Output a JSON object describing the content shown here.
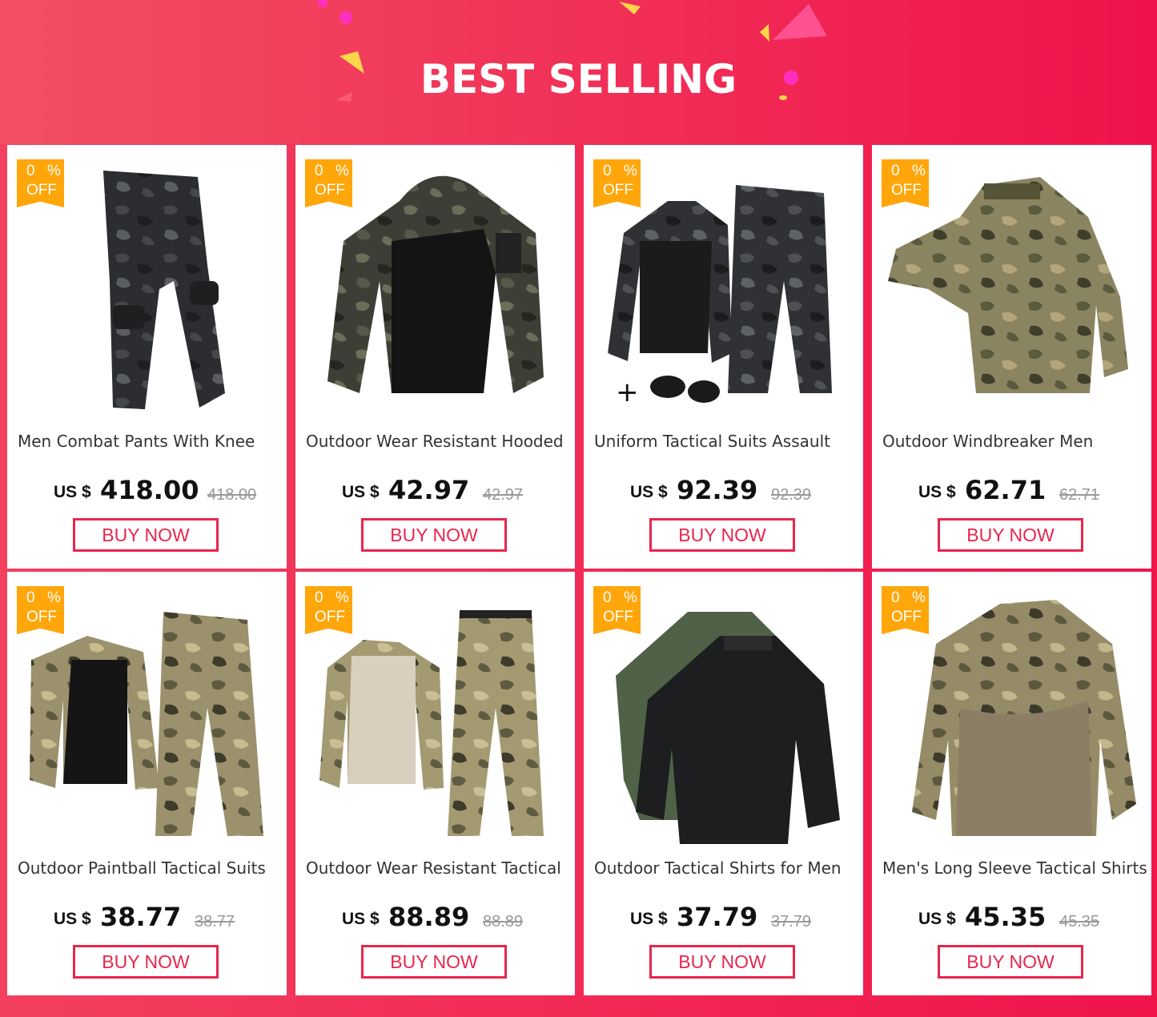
{
  "header": {
    "title": "BEST SELLING"
  },
  "colors": {
    "accent": "#e8264e",
    "badge": "#ffa60a"
  },
  "products": [
    {
      "name": "Men Combat Pants With Knee",
      "badge_pct": "0",
      "badge_sym": "%",
      "badge_off": "OFF",
      "currency": "US $",
      "price": "418.00",
      "old_price": "418.00",
      "button": "BUY NOW",
      "image": "camo-pants"
    },
    {
      "name": "Outdoor Wear Resistant Hooded",
      "badge_pct": "0",
      "badge_sym": "%",
      "badge_off": "OFF",
      "currency": "US $",
      "price": "42.97",
      "old_price": "42.97",
      "button": "BUY NOW",
      "image": "hooded-shirt"
    },
    {
      "name": "Uniform Tactical Suits Assault",
      "badge_pct": "0",
      "badge_sym": "%",
      "badge_off": "OFF",
      "currency": "US $",
      "price": "92.39",
      "old_price": "92.39",
      "button": "BUY NOW",
      "image": "suit-with-pads"
    },
    {
      "name": "Outdoor Windbreaker Men",
      "badge_pct": "0",
      "badge_sym": "%",
      "badge_off": "OFF",
      "currency": "US $",
      "price": "62.71",
      "old_price": "62.71",
      "button": "BUY NOW",
      "image": "camo-jacket"
    },
    {
      "name": "Outdoor Paintball Tactical Suits",
      "badge_pct": "0",
      "badge_sym": "%",
      "badge_off": "OFF",
      "currency": "US $",
      "price": "38.77",
      "old_price": "38.77",
      "button": "BUY NOW",
      "image": "paintball-suit"
    },
    {
      "name": "Outdoor Wear Resistant Tactical",
      "badge_pct": "0",
      "badge_sym": "%",
      "badge_off": "OFF",
      "currency": "US $",
      "price": "88.89",
      "old_price": "88.89",
      "button": "BUY NOW",
      "image": "tan-suit"
    },
    {
      "name": "Outdoor Tactical Shirts for Men",
      "badge_pct": "0",
      "badge_sym": "%",
      "badge_off": "OFF",
      "currency": "US $",
      "price": "37.79",
      "old_price": "37.79",
      "button": "BUY NOW",
      "image": "green-black-shirts"
    },
    {
      "name": "Men's Long Sleeve Tactical Shirts",
      "badge_pct": "0",
      "badge_sym": "%",
      "badge_off": "OFF",
      "currency": "US $",
      "price": "45.35",
      "old_price": "45.35",
      "button": "BUY NOW",
      "image": "camo-long-sleeve"
    }
  ]
}
